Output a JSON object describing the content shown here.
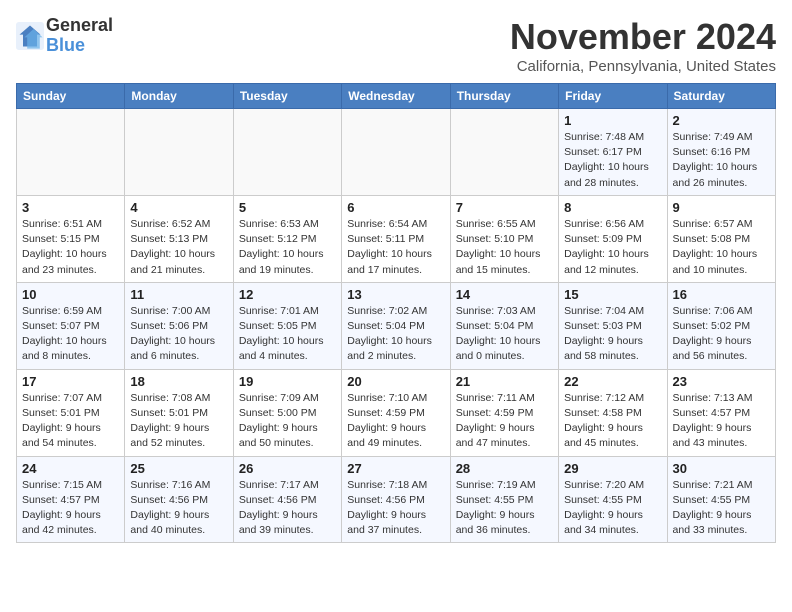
{
  "header": {
    "logo_general": "General",
    "logo_blue": "Blue",
    "month_title": "November 2024",
    "subtitle": "California, Pennsylvania, United States"
  },
  "calendar": {
    "days_of_week": [
      "Sunday",
      "Monday",
      "Tuesday",
      "Wednesday",
      "Thursday",
      "Friday",
      "Saturday"
    ],
    "weeks": [
      [
        {
          "day": "",
          "info": ""
        },
        {
          "day": "",
          "info": ""
        },
        {
          "day": "",
          "info": ""
        },
        {
          "day": "",
          "info": ""
        },
        {
          "day": "",
          "info": ""
        },
        {
          "day": "1",
          "info": "Sunrise: 7:48 AM\nSunset: 6:17 PM\nDaylight: 10 hours and 28 minutes."
        },
        {
          "day": "2",
          "info": "Sunrise: 7:49 AM\nSunset: 6:16 PM\nDaylight: 10 hours and 26 minutes."
        }
      ],
      [
        {
          "day": "3",
          "info": "Sunrise: 6:51 AM\nSunset: 5:15 PM\nDaylight: 10 hours and 23 minutes."
        },
        {
          "day": "4",
          "info": "Sunrise: 6:52 AM\nSunset: 5:13 PM\nDaylight: 10 hours and 21 minutes."
        },
        {
          "day": "5",
          "info": "Sunrise: 6:53 AM\nSunset: 5:12 PM\nDaylight: 10 hours and 19 minutes."
        },
        {
          "day": "6",
          "info": "Sunrise: 6:54 AM\nSunset: 5:11 PM\nDaylight: 10 hours and 17 minutes."
        },
        {
          "day": "7",
          "info": "Sunrise: 6:55 AM\nSunset: 5:10 PM\nDaylight: 10 hours and 15 minutes."
        },
        {
          "day": "8",
          "info": "Sunrise: 6:56 AM\nSunset: 5:09 PM\nDaylight: 10 hours and 12 minutes."
        },
        {
          "day": "9",
          "info": "Sunrise: 6:57 AM\nSunset: 5:08 PM\nDaylight: 10 hours and 10 minutes."
        }
      ],
      [
        {
          "day": "10",
          "info": "Sunrise: 6:59 AM\nSunset: 5:07 PM\nDaylight: 10 hours and 8 minutes."
        },
        {
          "day": "11",
          "info": "Sunrise: 7:00 AM\nSunset: 5:06 PM\nDaylight: 10 hours and 6 minutes."
        },
        {
          "day": "12",
          "info": "Sunrise: 7:01 AM\nSunset: 5:05 PM\nDaylight: 10 hours and 4 minutes."
        },
        {
          "day": "13",
          "info": "Sunrise: 7:02 AM\nSunset: 5:04 PM\nDaylight: 10 hours and 2 minutes."
        },
        {
          "day": "14",
          "info": "Sunrise: 7:03 AM\nSunset: 5:04 PM\nDaylight: 10 hours and 0 minutes."
        },
        {
          "day": "15",
          "info": "Sunrise: 7:04 AM\nSunset: 5:03 PM\nDaylight: 9 hours and 58 minutes."
        },
        {
          "day": "16",
          "info": "Sunrise: 7:06 AM\nSunset: 5:02 PM\nDaylight: 9 hours and 56 minutes."
        }
      ],
      [
        {
          "day": "17",
          "info": "Sunrise: 7:07 AM\nSunset: 5:01 PM\nDaylight: 9 hours and 54 minutes."
        },
        {
          "day": "18",
          "info": "Sunrise: 7:08 AM\nSunset: 5:01 PM\nDaylight: 9 hours and 52 minutes."
        },
        {
          "day": "19",
          "info": "Sunrise: 7:09 AM\nSunset: 5:00 PM\nDaylight: 9 hours and 50 minutes."
        },
        {
          "day": "20",
          "info": "Sunrise: 7:10 AM\nSunset: 4:59 PM\nDaylight: 9 hours and 49 minutes."
        },
        {
          "day": "21",
          "info": "Sunrise: 7:11 AM\nSunset: 4:59 PM\nDaylight: 9 hours and 47 minutes."
        },
        {
          "day": "22",
          "info": "Sunrise: 7:12 AM\nSunset: 4:58 PM\nDaylight: 9 hours and 45 minutes."
        },
        {
          "day": "23",
          "info": "Sunrise: 7:13 AM\nSunset: 4:57 PM\nDaylight: 9 hours and 43 minutes."
        }
      ],
      [
        {
          "day": "24",
          "info": "Sunrise: 7:15 AM\nSunset: 4:57 PM\nDaylight: 9 hours and 42 minutes."
        },
        {
          "day": "25",
          "info": "Sunrise: 7:16 AM\nSunset: 4:56 PM\nDaylight: 9 hours and 40 minutes."
        },
        {
          "day": "26",
          "info": "Sunrise: 7:17 AM\nSunset: 4:56 PM\nDaylight: 9 hours and 39 minutes."
        },
        {
          "day": "27",
          "info": "Sunrise: 7:18 AM\nSunset: 4:56 PM\nDaylight: 9 hours and 37 minutes."
        },
        {
          "day": "28",
          "info": "Sunrise: 7:19 AM\nSunset: 4:55 PM\nDaylight: 9 hours and 36 minutes."
        },
        {
          "day": "29",
          "info": "Sunrise: 7:20 AM\nSunset: 4:55 PM\nDaylight: 9 hours and 34 minutes."
        },
        {
          "day": "30",
          "info": "Sunrise: 7:21 AM\nSunset: 4:55 PM\nDaylight: 9 hours and 33 minutes."
        }
      ]
    ]
  }
}
